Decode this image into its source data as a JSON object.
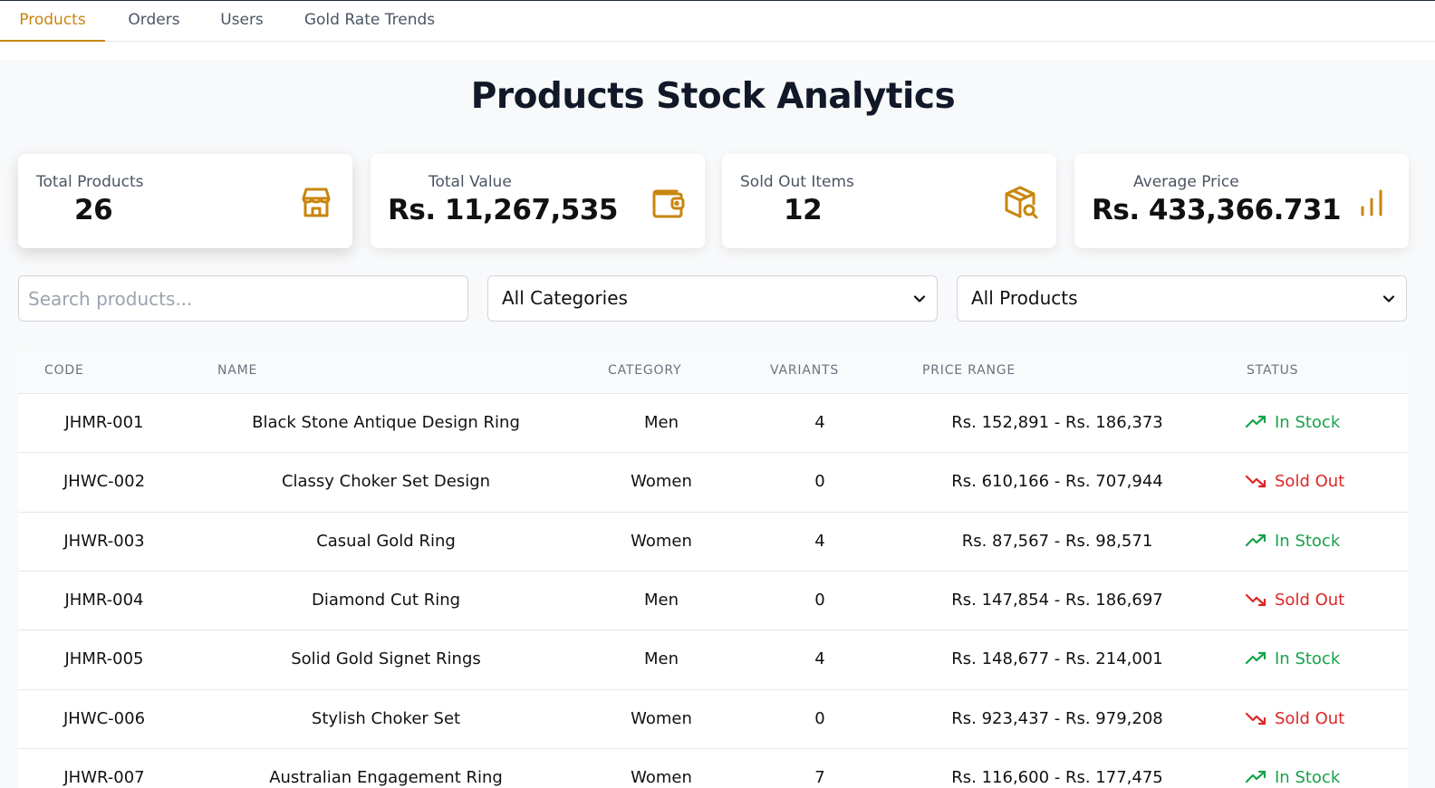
{
  "tabs": [
    {
      "label": "Products",
      "active": true
    },
    {
      "label": "Orders",
      "active": false
    },
    {
      "label": "Users",
      "active": false
    },
    {
      "label": "Gold Rate Trends",
      "active": false
    }
  ],
  "page_title": "Products Stock Analytics",
  "stats": [
    {
      "label": "Total Products",
      "value": "26",
      "icon": "store-icon"
    },
    {
      "label": "Total Value",
      "value": "Rs. 11,267,535",
      "icon": "wallet-icon"
    },
    {
      "label": "Sold Out Items",
      "value": "12",
      "icon": "package-search-icon"
    },
    {
      "label": "Average Price",
      "value": "Rs. 433,366.731",
      "icon": "bar-chart-icon"
    }
  ],
  "filters": {
    "search_placeholder": "Search products...",
    "category_selected": "All Categories",
    "product_selected": "All Products"
  },
  "table": {
    "headers": {
      "code": "CODE",
      "name": "NAME",
      "category": "CATEGORY",
      "variants": "VARIANTS",
      "price_range": "PRICE RANGE",
      "status": "STATUS"
    },
    "rows": [
      {
        "code": "JHMR-001",
        "name": "Black Stone Antique Design Ring",
        "category": "Men",
        "variants": "4",
        "price_range": "Rs. 152,891 - Rs. 186,373",
        "status": "In Stock"
      },
      {
        "code": "JHWC-002",
        "name": "Classy Choker Set Design",
        "category": "Women",
        "variants": "0",
        "price_range": "Rs. 610,166 - Rs. 707,944",
        "status": "Sold Out"
      },
      {
        "code": "JHWR-003",
        "name": "Casual Gold Ring",
        "category": "Women",
        "variants": "4",
        "price_range": "Rs. 87,567 - Rs. 98,571",
        "status": "In Stock"
      },
      {
        "code": "JHMR-004",
        "name": "Diamond Cut Ring",
        "category": "Men",
        "variants": "0",
        "price_range": "Rs. 147,854 - Rs. 186,697",
        "status": "Sold Out"
      },
      {
        "code": "JHMR-005",
        "name": "Solid Gold Signet Rings",
        "category": "Men",
        "variants": "4",
        "price_range": "Rs. 148,677 - Rs. 214,001",
        "status": "In Stock"
      },
      {
        "code": "JHWC-006",
        "name": "Stylish Choker Set",
        "category": "Women",
        "variants": "0",
        "price_range": "Rs. 923,437 - Rs. 979,208",
        "status": "Sold Out"
      },
      {
        "code": "JHWR-007",
        "name": "Australian Engagement Ring",
        "category": "Women",
        "variants": "7",
        "price_range": "Rs. 116,600 - Rs. 177,475",
        "status": "In Stock"
      }
    ]
  },
  "colors": {
    "accent": "#c8860d",
    "in_stock": "#16a34a",
    "sold_out": "#dc2626"
  }
}
